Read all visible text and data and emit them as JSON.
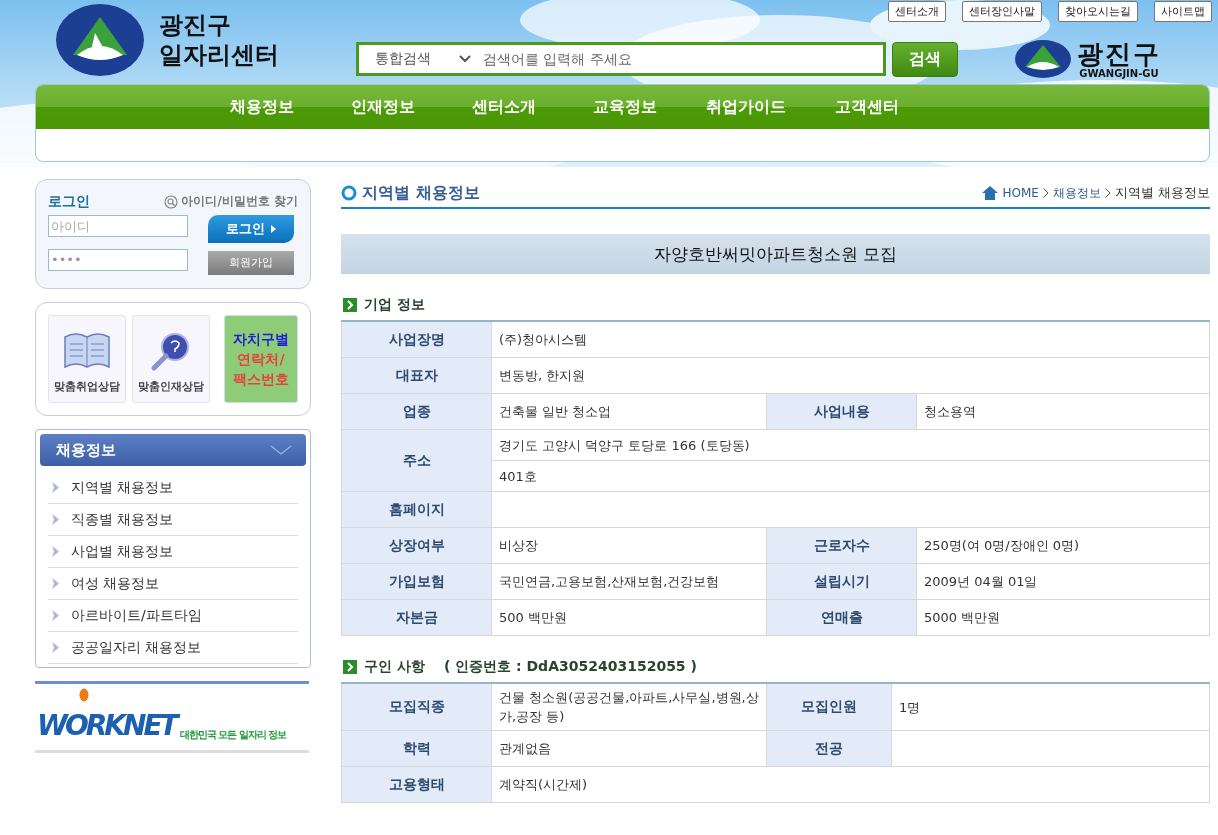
{
  "top_links": [
    "센터소개",
    "센터장인사말",
    "찾아오시는길",
    "사이트맵"
  ],
  "logo": {
    "line_1": "광진구",
    "line_2": "일자리센터"
  },
  "search": {
    "scope": "통합검색",
    "placeholder": "검색어를 입력해 주세요",
    "button": "검색"
  },
  "district_logo": {
    "name": "광진구",
    "romanized": "GWANGJIN-GU"
  },
  "nav": [
    "채용정보",
    "인재정보",
    "센터소개",
    "교육정보",
    "취업가이드",
    "고객센터"
  ],
  "login": {
    "title": "로그인",
    "find_link": "아이디/비밀번호 찾기",
    "id_placeholder": "아이디",
    "password_value": "••••",
    "login_button": "로그인",
    "join_button": "회원가입"
  },
  "quick_links": [
    {
      "kind": "book",
      "label": "맞춤취업상담"
    },
    {
      "kind": "magnifier",
      "label": "맞춤인재상담"
    },
    {
      "kind": "text",
      "lines": [
        {
          "text": "자치구별",
          "color": "#1f1fd6"
        },
        {
          "text": "연락처/",
          "color": "#e8403f"
        },
        {
          "text": "팩스번호",
          "color": "#e8403f"
        }
      ]
    }
  ],
  "menu": {
    "title": "채용정보",
    "items": [
      "지역별 채용정보",
      "직종별 채용정보",
      "사업별 채용정보",
      "여성 채용정보",
      "아르바이트/파트타임",
      "공공일자리 채용정보"
    ]
  },
  "banner": {
    "logo": "WORKNET",
    "tagline": "대한민국 모든 일자리 정보"
  },
  "page_title": "지역별 채용정보",
  "breadcrumb": [
    "HOME",
    "채용정보",
    "지역별 채용정보"
  ],
  "job_title": "자양호반써밋아파트청소원 모집",
  "company_section": {
    "title": "기업 정보",
    "rows": [
      {
        "cells": [
          {
            "label": "사업장명",
            "value": "(주)청아시스템"
          }
        ]
      },
      {
        "cells": [
          {
            "label": "대표자",
            "value": "변동방, 한지원"
          }
        ]
      },
      {
        "cells": [
          {
            "label": "업종",
            "value": "건축물 일반 청소업"
          },
          {
            "label": "사업내용",
            "value": "청소용역"
          }
        ]
      },
      {
        "cells": [
          {
            "label": "주소",
            "lines": [
              "경기도 고양시 덕양구 토당로 166 (토당동)",
              "401호"
            ]
          }
        ]
      },
      {
        "cells": [
          {
            "label": "홈페이지"
          }
        ]
      },
      {
        "cells": [
          {
            "label": "상장여부",
            "value": "비상장"
          },
          {
            "label": "근로자수",
            "value": "250명(여 0명/장애인 0명)"
          }
        ]
      },
      {
        "cells": [
          {
            "label": "가입보험",
            "value": "국민연금,고용보험,산재보험,건강보험"
          },
          {
            "label": "설립시기",
            "value": "2009년 04월 01일"
          }
        ]
      },
      {
        "cells": [
          {
            "label": "자본금",
            "value": "500 백만원"
          },
          {
            "label": "연매출",
            "value": "5000 백만원"
          }
        ]
      }
    ]
  },
  "recruit_section": {
    "title": "구인 사항",
    "cert": "( 인증번호 : DdA3052403152055 )",
    "rows": [
      {
        "cells": [
          {
            "label": "모집직종",
            "value": "건물 청소원(공공건물,아파트,사무실,병원,상가,공장 등)"
          },
          {
            "label": "모집인원",
            "value": "1명"
          }
        ]
      },
      {
        "cells": [
          {
            "label": "학력",
            "value": "관계없음"
          },
          {
            "label": "전공"
          }
        ]
      },
      {
        "cells": [
          {
            "label": "고용형태",
            "value": "계약직(시간제)"
          }
        ]
      }
    ]
  }
}
